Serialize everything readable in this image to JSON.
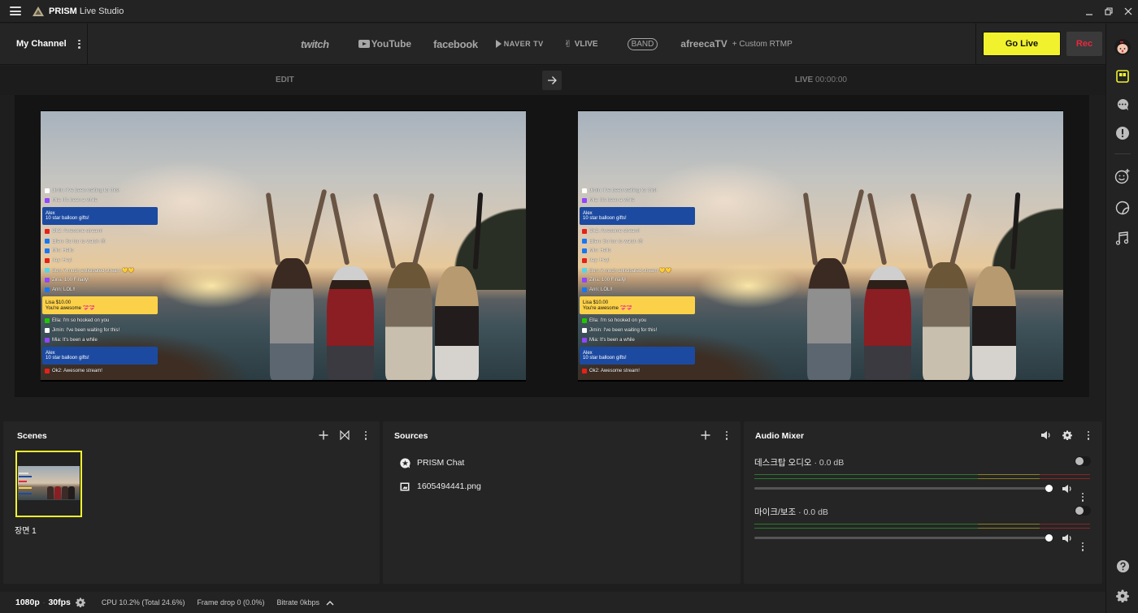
{
  "titlebar": {
    "app_name_bold": "PRISM",
    "app_name_rest": " Live Studio",
    "menu_icon": "hamburger-icon",
    "window_controls": [
      "minimize",
      "restore",
      "close"
    ]
  },
  "channel_bar": {
    "my_channel_label": "My Channel",
    "platforms": [
      "twitch",
      "YouTube",
      "facebook",
      "NAVER TV",
      "VLIVE",
      "BAND",
      "afreecaTV"
    ],
    "custom_rtmp_label": "+ Custom RTMP",
    "go_live_label": "Go Live",
    "rec_label": "Rec"
  },
  "colors": {
    "accent_yellow": "#f1f12e",
    "rec_red": "#e8273f",
    "background": "#1e1e1e",
    "panel": "#252525"
  },
  "mode_bar": {
    "edit_label": "EDIT",
    "live_label": "LIVE",
    "live_timer": "00:00:00",
    "swap_icon": "arrow-right-icon"
  },
  "preview_chat": {
    "lines": [
      {
        "type": "line",
        "platform": "naver",
        "text": "Jimin: I've been waiting for this!"
      },
      {
        "type": "line",
        "platform": "twitch",
        "text": "Mia: It's been a while"
      },
      {
        "type": "card",
        "style": "blue",
        "name": "Alex",
        "text": "10 star balloon gifts!"
      },
      {
        "type": "line",
        "platform": "youtube",
        "text": "Ok2: Awesome stream!"
      },
      {
        "type": "line",
        "platform": "facebook",
        "text": "Ellen: So fun to watch 😍"
      },
      {
        "type": "line",
        "platform": "facebook",
        "text": "Min: Hello"
      },
      {
        "type": "line",
        "platform": "youtube",
        "text": "Jay: Hey!"
      },
      {
        "type": "line",
        "platform": "vlive",
        "text": "Sun: A much anticipated stream 💛💛"
      },
      {
        "type": "line",
        "platform": "twitch",
        "text": "Zina: 100 Finally!"
      },
      {
        "type": "line",
        "platform": "facebook",
        "text": "Ann: LOL!!"
      },
      {
        "type": "card",
        "style": "yellow",
        "name": "Lisa $10.00",
        "text": "You're awesome 💝💝"
      },
      {
        "type": "line",
        "platform": "naver-tv",
        "text": "Ella: I'm so hooked on you"
      },
      {
        "type": "line",
        "platform": "naver",
        "text": "Jimin: I've been waiting for this!"
      },
      {
        "type": "line",
        "platform": "twitch",
        "text": "Mia: It's been a while"
      },
      {
        "type": "card",
        "style": "blue",
        "name": "Alex",
        "text": "10 star balloon gifts!"
      },
      {
        "type": "line",
        "platform": "youtube",
        "text": "Ok2: Awesome stream!"
      }
    ]
  },
  "scenes": {
    "title": "Scenes",
    "items": [
      {
        "name": "장면 1",
        "selected": true
      }
    ]
  },
  "sources": {
    "title": "Sources",
    "items": [
      {
        "name": "PRISM Chat",
        "icon": "chat-star-icon"
      },
      {
        "name": "1605494441.png",
        "icon": "image-icon"
      }
    ]
  },
  "audio_mixer": {
    "title": "Audio Mixer",
    "channels": [
      {
        "name": "데스크탑 오디오",
        "db": "· 0.0 dB",
        "volume": 1.0,
        "enabled": false
      },
      {
        "name": "마이크/보조",
        "db": "· 0.0 dB",
        "volume": 1.0,
        "enabled": false
      }
    ]
  },
  "statusbar": {
    "resolution": "1080p",
    "fps": "30fps",
    "cpu": "CPU 10.2% (Total 24.6%)",
    "frame_drop": "Frame drop 0 (0.0%)",
    "bitrate": "Bitrate 0kbps"
  },
  "right_sidebar": {
    "items": [
      "profile-avatar",
      "layout",
      "chat",
      "notice",
      "beauty-effect",
      "sticker",
      "music"
    ],
    "bottom_items": [
      "help",
      "settings"
    ]
  }
}
